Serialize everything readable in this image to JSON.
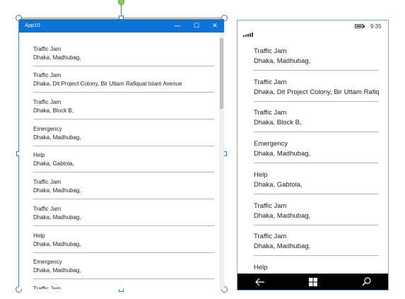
{
  "window": {
    "title": "App10",
    "minimize_glyph": "—",
    "maximize_glyph": "☐",
    "close_glyph": "✕"
  },
  "phone": {
    "time": "9:35"
  },
  "items": [
    {
      "type": "Traffic Jam",
      "address": "Dhaka, Madhubag,"
    },
    {
      "type": "Traffic Jam",
      "address": "Dhaka, Dit Project Colony, Bir Uttam Rafiqual Islam Avenue"
    },
    {
      "type": "Traffic Jam",
      "address": "Dhaka, Block B,"
    },
    {
      "type": "Emergency",
      "address": "Dhaka, Madhubag,"
    },
    {
      "type": "Help",
      "address": "Dhaka, Gabtola,"
    },
    {
      "type": "Traffic Jam",
      "address": "Dhaka, Madhubag,"
    },
    {
      "type": "Traffic Jam",
      "address": "Dhaka, Madhubag,"
    },
    {
      "type": "Help",
      "address": "Dhaka, Madhubag,"
    },
    {
      "type": "Emergency",
      "address": "Dhaka, Madhubag,"
    },
    {
      "type": "Traffic Jam",
      "address": ""
    }
  ],
  "colors": {
    "titlebar": "#0a74d9",
    "selection": "#4a8ad4",
    "rotate_handle": "#7dd64f",
    "nav_bar": "#000000"
  },
  "icons": {
    "nav_back": "back-arrow-icon",
    "nav_home": "windows-logo-icon",
    "nav_search": "search-icon"
  }
}
